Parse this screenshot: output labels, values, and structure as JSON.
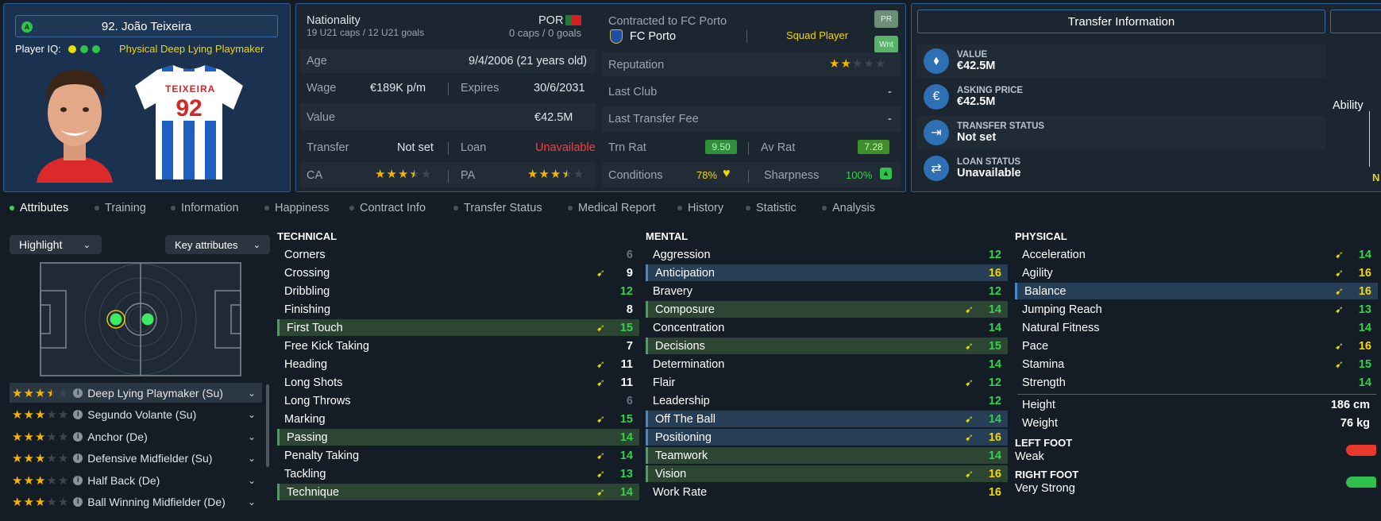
{
  "player": {
    "name": "92. João Teixeira",
    "iq_label": "Player IQ:",
    "role_label": "Physical Deep Lying Playmaker",
    "shirt_name": "TEIXEIRA",
    "shirt_number": "92",
    "badge": "A"
  },
  "info": {
    "nationality_label": "Nationality",
    "nationality": "POR",
    "u21": "19 U21 caps / 12 U21 goals",
    "caps": "0 caps / 0 goals",
    "age_label": "Age",
    "age": "9/4/2006 (21 years old)",
    "wage_label": "Wage",
    "wage": "€189K p/m",
    "expires_label": "Expires",
    "expires": "30/6/2031",
    "value_label": "Value",
    "value": "€42.5M",
    "transfer_label": "Transfer",
    "transfer": "Not set",
    "loan_label": "Loan",
    "loan": "Unavailable",
    "ca_label": "CA",
    "pa_label": "PA",
    "ca_stars": 3.5,
    "pa_stars": 3.5
  },
  "contract": {
    "contracted": "Contracted to FC Porto",
    "club": "FC Porto",
    "status": "Squad Player",
    "pr": "PR",
    "wnt": "Wnt",
    "reputation_label": "Reputation",
    "reputation_stars": 2,
    "last_club_label": "Last Club",
    "last_club": "-",
    "last_fee_label": "Last Transfer Fee",
    "last_fee": "-",
    "trn_rat_label": "Trn Rat",
    "trn_rat": "9.50",
    "av_rat_label": "Av Rat",
    "av_rat": "7.28",
    "conditions_label": "Conditions",
    "conditions": "78%",
    "sharpness_label": "Sharpness",
    "sharpness": "100%"
  },
  "transfer_info": {
    "title": "Transfer Information",
    "ability": "Ability",
    "n": "N",
    "rows": [
      {
        "label": "VALUE",
        "value": "€42.5M",
        "icon": "tag-icon"
      },
      {
        "label": "ASKING PRICE",
        "value": "€42.5M",
        "icon": "money-bag-icon"
      },
      {
        "label": "TRANSFER STATUS",
        "value": "Not set",
        "icon": "login-icon"
      },
      {
        "label": "LOAN STATUS",
        "value": "Unavailable",
        "icon": "swap-icon"
      }
    ]
  },
  "tabs": [
    "Attributes",
    "Training",
    "Information",
    "Happiness",
    "Contract Info",
    "Transfer Status",
    "Medical Report",
    "History",
    "Statistic",
    "Analysis"
  ],
  "left": {
    "highlight": "Highlight",
    "key_attributes": "Key attributes",
    "roles": [
      {
        "name": "Deep Lying Playmaker (Su)",
        "stars": 3.5
      },
      {
        "name": "Segundo Volante (Su)",
        "stars": 3
      },
      {
        "name": "Anchor (De)",
        "stars": 3
      },
      {
        "name": "Defensive Midfielder (Su)",
        "stars": 3
      },
      {
        "name": "Half Back (De)",
        "stars": 3
      },
      {
        "name": "Ball Winning Midfielder (De)",
        "stars": 3
      }
    ]
  },
  "technical": {
    "title": "TECHNICAL",
    "rows": [
      {
        "n": "Corners",
        "v": "6",
        "c": "grey",
        "h": "",
        "a": false
      },
      {
        "n": "Crossing",
        "v": "9",
        "c": "w",
        "h": "",
        "a": true
      },
      {
        "n": "Dribbling",
        "v": "12",
        "c": "g",
        "h": "",
        "a": false
      },
      {
        "n": "Finishing",
        "v": "8",
        "c": "w",
        "h": "",
        "a": false
      },
      {
        "n": "First Touch",
        "v": "15",
        "c": "g",
        "h": "g",
        "a": true
      },
      {
        "n": "Free Kick Taking",
        "v": "7",
        "c": "w",
        "h": "",
        "a": false
      },
      {
        "n": "Heading",
        "v": "11",
        "c": "w",
        "h": "",
        "a": true
      },
      {
        "n": "Long Shots",
        "v": "11",
        "c": "w",
        "h": "",
        "a": true
      },
      {
        "n": "Long Throws",
        "v": "6",
        "c": "grey",
        "h": "",
        "a": false
      },
      {
        "n": "Marking",
        "v": "15",
        "c": "g",
        "h": "",
        "a": true
      },
      {
        "n": "Passing",
        "v": "14",
        "c": "g",
        "h": "g",
        "a": false
      },
      {
        "n": "Penalty Taking",
        "v": "14",
        "c": "g",
        "h": "",
        "a": true
      },
      {
        "n": "Tackling",
        "v": "13",
        "c": "g",
        "h": "",
        "a": true
      },
      {
        "n": "Technique",
        "v": "14",
        "c": "g",
        "h": "g",
        "a": true
      }
    ]
  },
  "mental": {
    "title": "MENTAL",
    "rows": [
      {
        "n": "Aggression",
        "v": "12",
        "c": "g",
        "h": "",
        "a": false
      },
      {
        "n": "Anticipation",
        "v": "16",
        "c": "y",
        "h": "b",
        "a": false
      },
      {
        "n": "Bravery",
        "v": "12",
        "c": "g",
        "h": "",
        "a": false
      },
      {
        "n": "Composure",
        "v": "14",
        "c": "g",
        "h": "g",
        "a": true
      },
      {
        "n": "Concentration",
        "v": "14",
        "c": "g",
        "h": "",
        "a": false
      },
      {
        "n": "Decisions",
        "v": "15",
        "c": "g",
        "h": "g",
        "a": true
      },
      {
        "n": "Determination",
        "v": "14",
        "c": "g",
        "h": "",
        "a": false
      },
      {
        "n": "Flair",
        "v": "12",
        "c": "g",
        "h": "",
        "a": true
      },
      {
        "n": "Leadership",
        "v": "12",
        "c": "g",
        "h": "",
        "a": false
      },
      {
        "n": "Off The Ball",
        "v": "14",
        "c": "g",
        "h": "b",
        "a": true
      },
      {
        "n": "Positioning",
        "v": "16",
        "c": "y",
        "h": "b",
        "a": true
      },
      {
        "n": "Teamwork",
        "v": "14",
        "c": "g",
        "h": "g",
        "a": false
      },
      {
        "n": "Vision",
        "v": "16",
        "c": "y",
        "h": "g",
        "a": true
      },
      {
        "n": "Work Rate",
        "v": "16",
        "c": "y",
        "h": "",
        "a": false
      }
    ]
  },
  "physical": {
    "title": "PHYSICAL",
    "rows": [
      {
        "n": "Acceleration",
        "v": "14",
        "c": "g",
        "h": "",
        "a": true
      },
      {
        "n": "Agility",
        "v": "16",
        "c": "y",
        "h": "",
        "a": true
      },
      {
        "n": "Balance",
        "v": "16",
        "c": "y",
        "h": "b",
        "a": true
      },
      {
        "n": "Jumping Reach",
        "v": "13",
        "c": "g",
        "h": "",
        "a": true
      },
      {
        "n": "Natural Fitness",
        "v": "14",
        "c": "g",
        "h": "",
        "a": false
      },
      {
        "n": "Pace",
        "v": "16",
        "c": "y",
        "h": "",
        "a": true
      },
      {
        "n": "Stamina",
        "v": "15",
        "c": "g",
        "h": "",
        "a": true
      },
      {
        "n": "Strength",
        "v": "14",
        "c": "g",
        "h": "",
        "a": false
      }
    ],
    "height_label": "Height",
    "height": "186 cm",
    "weight_label": "Weight",
    "weight": "76 kg",
    "left_foot_label": "LEFT FOOT",
    "left_foot": "Weak",
    "right_foot_label": "RIGHT FOOT",
    "right_foot": "Very Strong"
  }
}
